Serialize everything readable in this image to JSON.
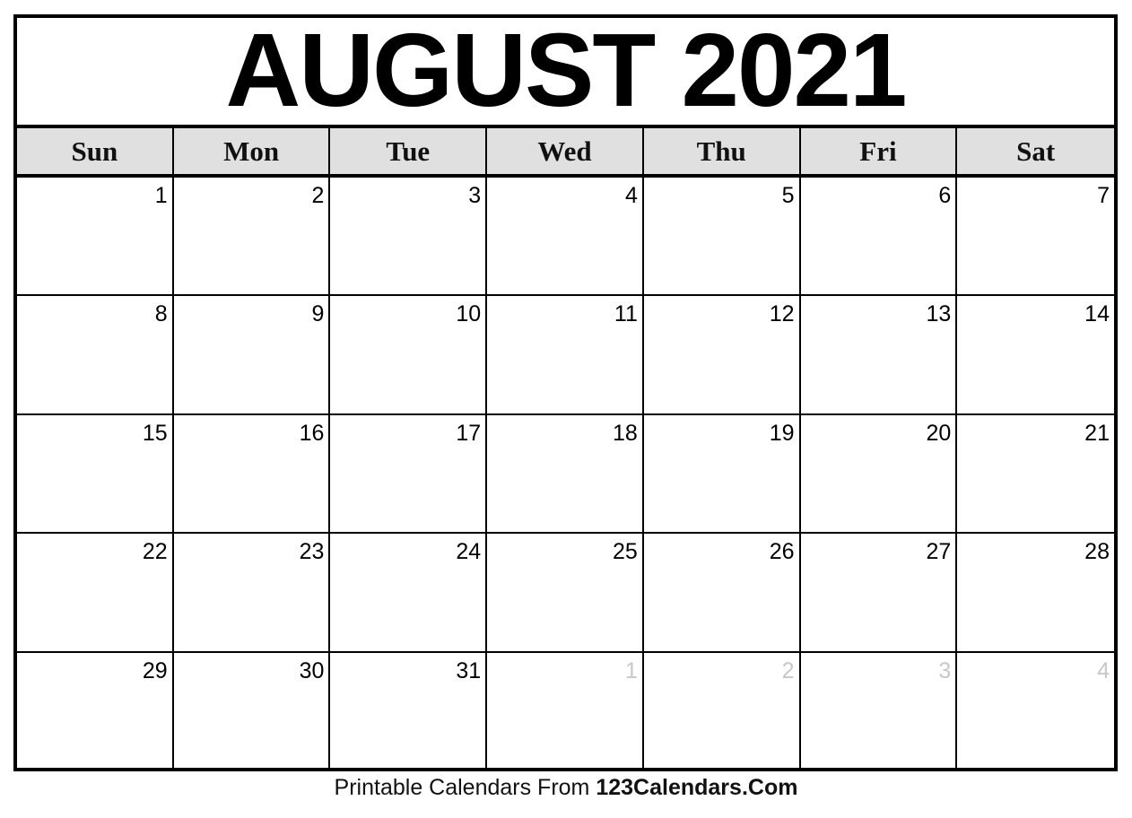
{
  "title": "AUGUST 2021",
  "weekdays": [
    "Sun",
    "Mon",
    "Tue",
    "Wed",
    "Thu",
    "Fri",
    "Sat"
  ],
  "days": [
    {
      "n": "1",
      "muted": false
    },
    {
      "n": "2",
      "muted": false
    },
    {
      "n": "3",
      "muted": false
    },
    {
      "n": "4",
      "muted": false
    },
    {
      "n": "5",
      "muted": false
    },
    {
      "n": "6",
      "muted": false
    },
    {
      "n": "7",
      "muted": false
    },
    {
      "n": "8",
      "muted": false
    },
    {
      "n": "9",
      "muted": false
    },
    {
      "n": "10",
      "muted": false
    },
    {
      "n": "11",
      "muted": false
    },
    {
      "n": "12",
      "muted": false
    },
    {
      "n": "13",
      "muted": false
    },
    {
      "n": "14",
      "muted": false
    },
    {
      "n": "15",
      "muted": false
    },
    {
      "n": "16",
      "muted": false
    },
    {
      "n": "17",
      "muted": false
    },
    {
      "n": "18",
      "muted": false
    },
    {
      "n": "19",
      "muted": false
    },
    {
      "n": "20",
      "muted": false
    },
    {
      "n": "21",
      "muted": false
    },
    {
      "n": "22",
      "muted": false
    },
    {
      "n": "23",
      "muted": false
    },
    {
      "n": "24",
      "muted": false
    },
    {
      "n": "25",
      "muted": false
    },
    {
      "n": "26",
      "muted": false
    },
    {
      "n": "27",
      "muted": false
    },
    {
      "n": "28",
      "muted": false
    },
    {
      "n": "29",
      "muted": false
    },
    {
      "n": "30",
      "muted": false
    },
    {
      "n": "31",
      "muted": false
    },
    {
      "n": "1",
      "muted": true
    },
    {
      "n": "2",
      "muted": true
    },
    {
      "n": "3",
      "muted": true
    },
    {
      "n": "4",
      "muted": true
    }
  ],
  "footer": {
    "prefix": "Printable Calendars From ",
    "brand": "123Calendars.Com"
  },
  "colors": {
    "header_bg": "#e0e0e0",
    "muted_day": "#c8c8c8",
    "border": "#000000"
  }
}
